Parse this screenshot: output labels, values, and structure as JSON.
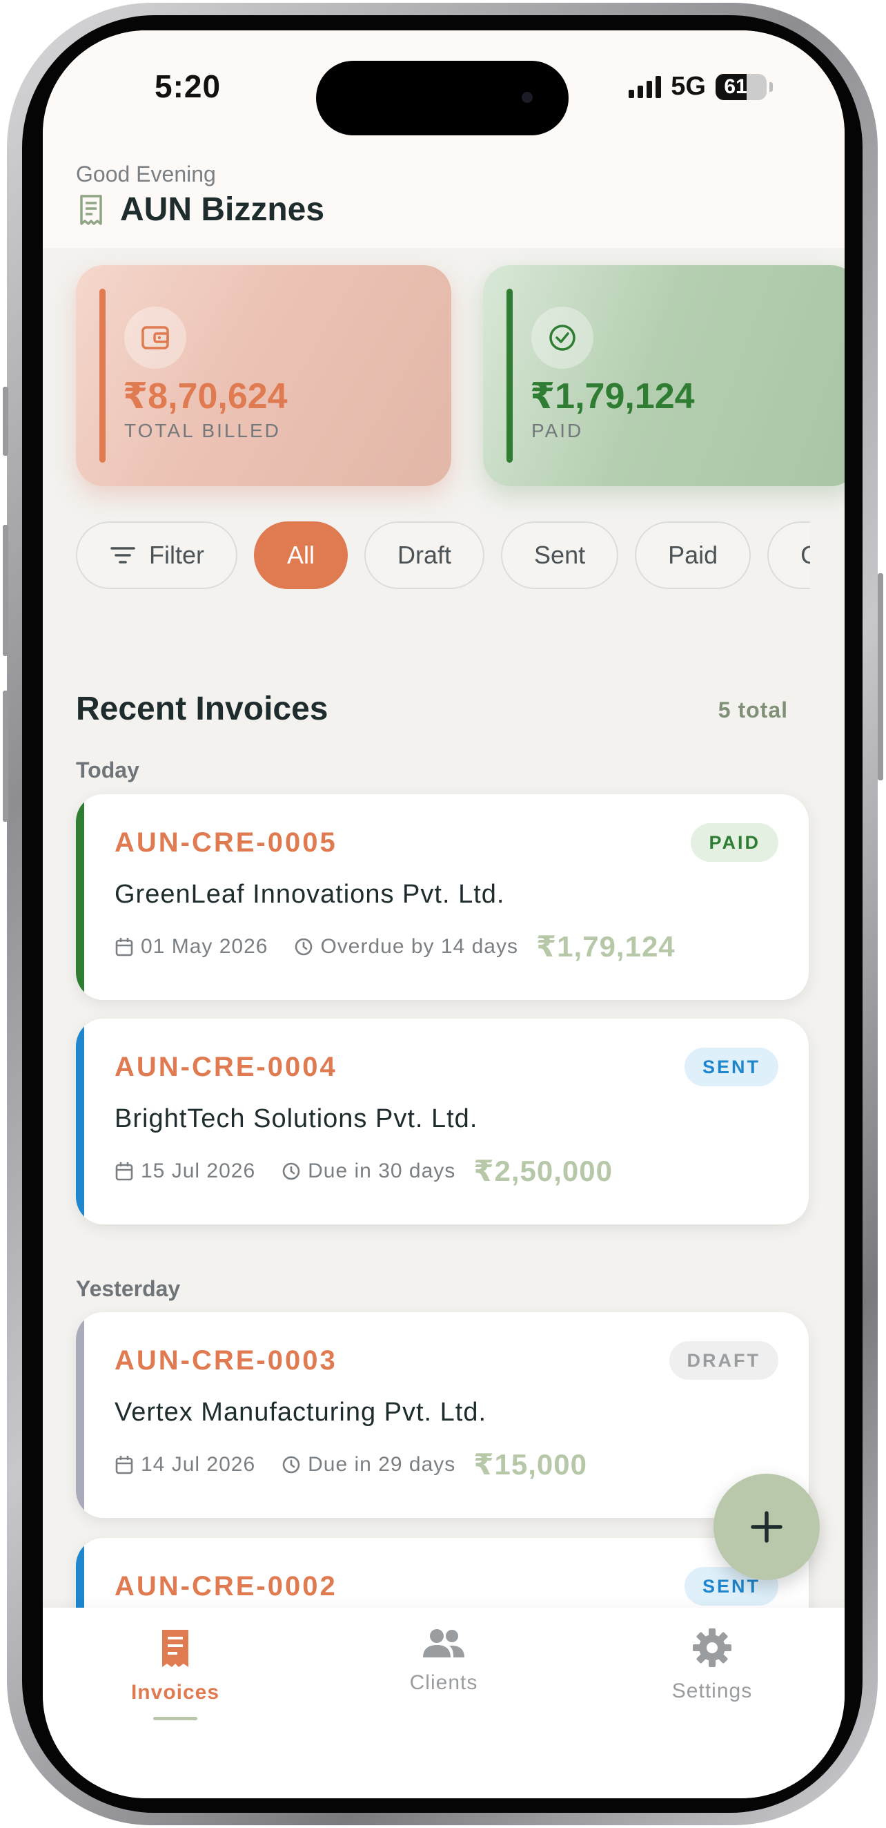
{
  "status_bar": {
    "time": "5:20",
    "network": "5G",
    "battery": "61",
    "battery_level": 0.61
  },
  "header": {
    "greeting": "Good Evening",
    "business_name": "AUN Bizznes",
    "icon": "receipt-icon"
  },
  "summary": {
    "total_billed": {
      "amount": "₹8,70,624",
      "label": "TOTAL BILLED",
      "icon": "wallet-icon",
      "color": "#e07a50"
    },
    "paid": {
      "amount": "₹1,79,124",
      "label": "PAID",
      "icon": "check-circle-icon",
      "color": "#2f7d33"
    }
  },
  "filters": {
    "filter_label": "Filter",
    "chips": [
      "All",
      "Draft",
      "Sent",
      "Paid",
      "C"
    ],
    "active": "All"
  },
  "section": {
    "title": "Recent Invoices",
    "count": "5 total"
  },
  "groups": {
    "today": "Today",
    "yesterday": "Yesterday"
  },
  "invoices": [
    {
      "id": "AUN-CRE-0005",
      "status": "PAID",
      "client": "GreenLeaf Innovations Pvt. Ltd.",
      "date": "01 May 2026",
      "due": "Overdue by 14 days",
      "amount": "₹1,79,124",
      "accent": "#2f7d33"
    },
    {
      "id": "AUN-CRE-0004",
      "status": "SENT",
      "client": "BrightTech Solutions Pvt. Ltd.",
      "date": "15 Jul 2026",
      "due": "Due in 30 days",
      "amount": "₹2,50,000",
      "accent": "#1e86cc"
    },
    {
      "id": "AUN-CRE-0003",
      "status": "DRAFT",
      "client": "Vertex Manufacturing Pvt. Ltd.",
      "date": "14 Jul 2026",
      "due": "Due in 29 days",
      "amount": "₹15,000",
      "accent": "#a9abbb"
    },
    {
      "id": "AUN-CRE-0002",
      "status": "SENT",
      "accent": "#1e86cc"
    }
  ],
  "fab": {
    "icon": "plus-icon"
  },
  "bottom_nav": {
    "items": [
      {
        "label": "Invoices",
        "icon": "invoice-icon",
        "active": true
      },
      {
        "label": "Clients",
        "icon": "people-icon",
        "active": false
      },
      {
        "label": "Settings",
        "icon": "gear-icon",
        "active": false
      }
    ],
    "active_color": "#e07a50",
    "inactive_color": "#9a9da0"
  }
}
